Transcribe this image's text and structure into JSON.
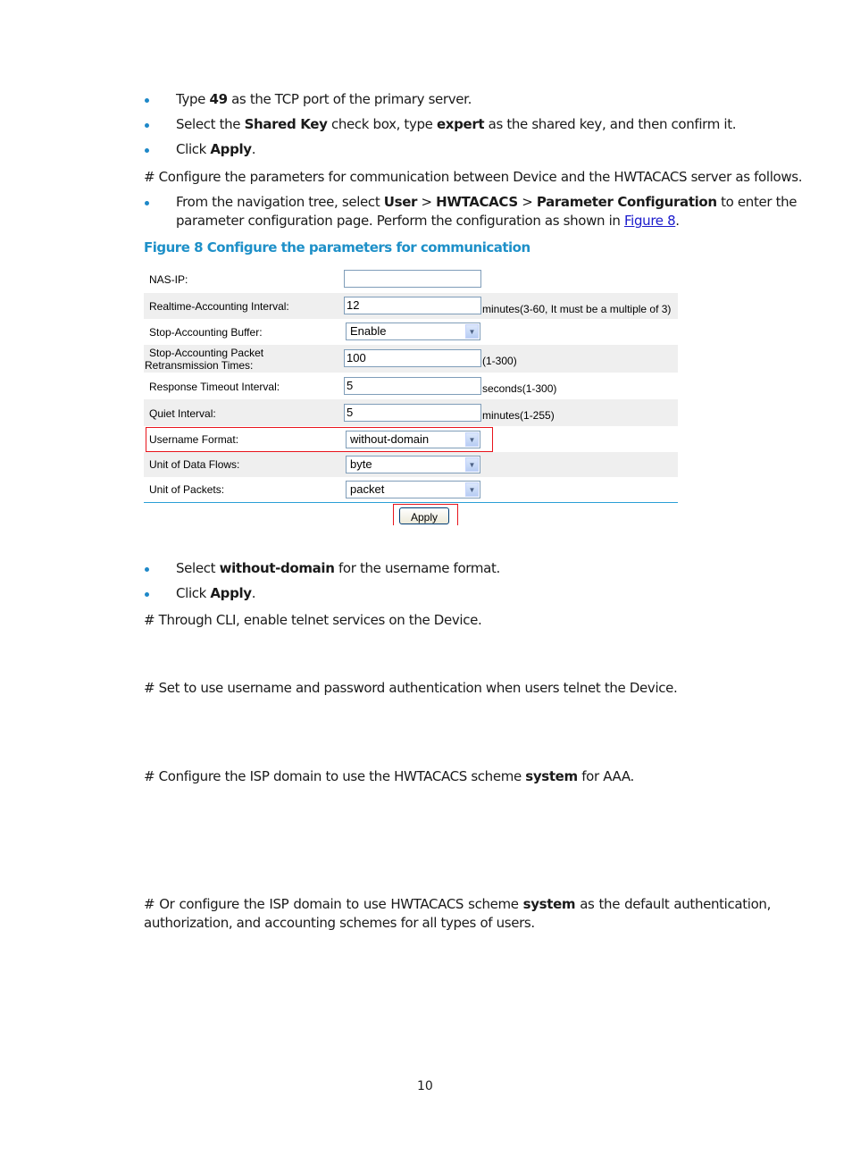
{
  "steps_top": [
    {
      "parts": [
        {
          "t": "Type "
        },
        {
          "b": "49"
        },
        {
          "t": " as the TCP port of the primary server."
        }
      ]
    },
    {
      "parts": [
        {
          "t": "Select the "
        },
        {
          "b": "Shared Key"
        },
        {
          "t": " check box, type "
        },
        {
          "b": "expert"
        },
        {
          "t": " as the shared key, and then confirm it."
        }
      ]
    },
    {
      "parts": [
        {
          "t": "Click "
        },
        {
          "b": "Apply"
        },
        {
          "t": "."
        }
      ]
    }
  ],
  "para_configure": "# Configure the parameters for communication between Device and the HWTACACS server as follows.",
  "nav_step": {
    "line1_prefix": "From the navigation tree, select ",
    "user": "User",
    "sep": " > ",
    "hwtacacs": "HWTACACS",
    "param_config": "Parameter Configuration",
    "line1_suffix": " to enter the",
    "line2_prefix": "parameter configuration page. Perform the configuration as shown in ",
    "link": "Figure 8",
    "line2_suffix": "."
  },
  "figure_caption": "Figure 8 Configure the parameters for communication",
  "form": {
    "nas_ip": {
      "label": "NAS-IP:",
      "value": ""
    },
    "realtime_interval": {
      "label": "Realtime-Accounting Interval:",
      "value": "12",
      "hint": "minutes(3-60, It must be a multiple of 3)"
    },
    "stop_buffer": {
      "label": "Stop-Accounting Buffer:",
      "value": "Enable"
    },
    "stop_retrans": {
      "label_line1": "Stop-Accounting Packet",
      "label_line2": "Retransmission Times:",
      "value": "100",
      "hint": "(1-300)"
    },
    "response_timeout": {
      "label": "Response Timeout Interval:",
      "value": "5",
      "hint": "seconds(1-300)"
    },
    "quiet_interval": {
      "label": "Quiet Interval:",
      "value": "5",
      "hint": "minutes(1-255)"
    },
    "username_format": {
      "label": "Username Format:",
      "value": "without-domain"
    },
    "unit_data_flows": {
      "label": "Unit of Data Flows:",
      "value": "byte"
    },
    "unit_packets": {
      "label": "Unit of Packets:",
      "value": "packet"
    },
    "apply_label": "Apply",
    "highlight_color": "#e8141c",
    "divider_color": "#2a9fd6"
  },
  "steps_bottom": [
    {
      "parts": [
        {
          "t": "Select "
        },
        {
          "b": "without-domain"
        },
        {
          "t": " for the username format."
        }
      ]
    },
    {
      "parts": [
        {
          "t": "Click "
        },
        {
          "b": "Apply"
        },
        {
          "t": "."
        }
      ]
    }
  ],
  "para_cli": "# Through CLI, enable telnet services on the Device.",
  "para_auth": "# Set to use username and password authentication when users telnet the Device.",
  "para_isp": {
    "prefix": "# Configure the ISP domain to use the HWTACACS scheme ",
    "bold": "system",
    "suffix": " for AAA."
  },
  "para_or": {
    "prefix": "# Or configure the ISP domain to use HWTACACS scheme ",
    "bold": "system",
    "suffix": " as the default authentication, authorization, and accounting schemes for all types of users."
  },
  "page_number": "10",
  "colors": {
    "accent": "#1e90c8",
    "link": "#1a1acc",
    "bullet": "#1e88c8"
  }
}
